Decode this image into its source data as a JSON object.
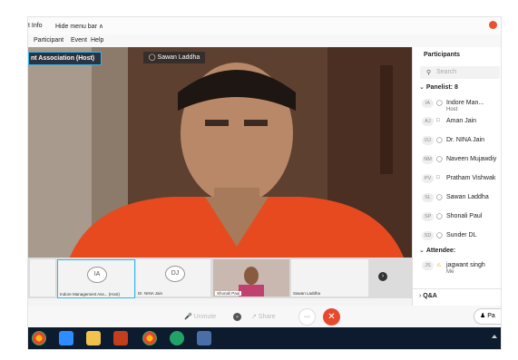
{
  "topbar": {
    "info": "t Info",
    "hide_menu": "Hide menu bar ∧"
  },
  "menu": {
    "items": [
      "Participant",
      "Event",
      "Help"
    ]
  },
  "video": {
    "host_label": "nt Association (Host)",
    "speaker_label": "Sawan Laddha"
  },
  "sidebar": {
    "title": "Participants",
    "search_placeholder": "Search",
    "panelists_header": "Panelist: 8",
    "panelists": [
      {
        "initials": "IA",
        "name": "Indore Man...",
        "role": "Host"
      },
      {
        "initials": "AJ",
        "name": "Aman Jain",
        "role": ""
      },
      {
        "initials": "DJ",
        "name": "Dr. NINA Jain",
        "role": ""
      },
      {
        "initials": "NM",
        "name": "Naveen Mujawdiy",
        "role": ""
      },
      {
        "initials": "PV",
        "name": "Pratham Vishwak",
        "role": ""
      },
      {
        "initials": "SL",
        "name": "Sawan Laddha",
        "role": ""
      },
      {
        "initials": "SP",
        "name": "Shonali Paul",
        "role": ""
      },
      {
        "initials": "SD",
        "name": "Sunder DL",
        "role": ""
      }
    ],
    "attendees_header": "Attendee:",
    "attendees": [
      {
        "initials": "JS",
        "name": "jagwant singh",
        "role": "Me"
      }
    ],
    "qa_label": "Q&A"
  },
  "thumbs": [
    {
      "initials": "IA",
      "label": "Indore Management Ass... (Host)"
    },
    {
      "initials": "DJ",
      "label": "Dr. NINA Jain"
    },
    {
      "initials": "",
      "label": "Shonali Paul"
    },
    {
      "initials": "",
      "label": "Sawan Laddha"
    }
  ],
  "controls": {
    "unmute": "Unmute",
    "share": "Share",
    "more": "···",
    "participants_btn": "Pa"
  }
}
